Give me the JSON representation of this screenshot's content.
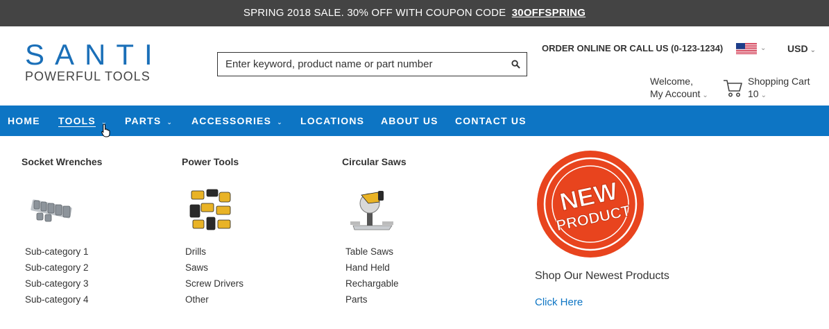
{
  "promo": {
    "text": "SPRING 2018 SALE. 30% OFF WITH COUPON CODE",
    "code": "30OFFSPRING"
  },
  "logo": {
    "brand": "SANTI",
    "tagline": "POWERFUL TOOLS"
  },
  "search": {
    "placeholder": "Enter keyword, product name or part number",
    "icon": "search-icon"
  },
  "header": {
    "order_text": "ORDER ONLINE OR CALL US (0-123-1234)",
    "flag": "us-flag-icon",
    "currency": "USD",
    "welcome": "Welcome,",
    "account": "My Account",
    "cart_label": "Shopping Cart",
    "cart_count": "10"
  },
  "nav": {
    "items": [
      {
        "label": "HOME"
      },
      {
        "label": "TOOLS"
      },
      {
        "label": "PARTS"
      },
      {
        "label": "ACCESSORIES"
      },
      {
        "label": "LOCATIONS"
      },
      {
        "label": "ABOUT US"
      },
      {
        "label": "CONTACT US"
      }
    ]
  },
  "menu": {
    "columns": [
      {
        "title": "Socket Wrenches",
        "image": "socket-wrench-set-icon",
        "items": [
          "Sub-category 1",
          "Sub-category 2",
          "Sub-category 3",
          "Sub-category 4"
        ]
      },
      {
        "title": "Power Tools",
        "image": "power-tools-set-icon",
        "items": [
          "Drills",
          "Saws",
          "Screw Drivers",
          "Other"
        ]
      },
      {
        "title": "Circular Saws",
        "image": "miter-saw-icon",
        "items": [
          "Table Saws",
          "Hand Held",
          "Rechargable",
          "Parts"
        ]
      }
    ],
    "promo": {
      "badge": "NEW PRODUCT",
      "text": "Shop Our Newest Products",
      "link": "Click Here"
    }
  },
  "colors": {
    "accent": "#0d75c4",
    "promo_bar": "#444444",
    "badge": "#e8441e"
  }
}
